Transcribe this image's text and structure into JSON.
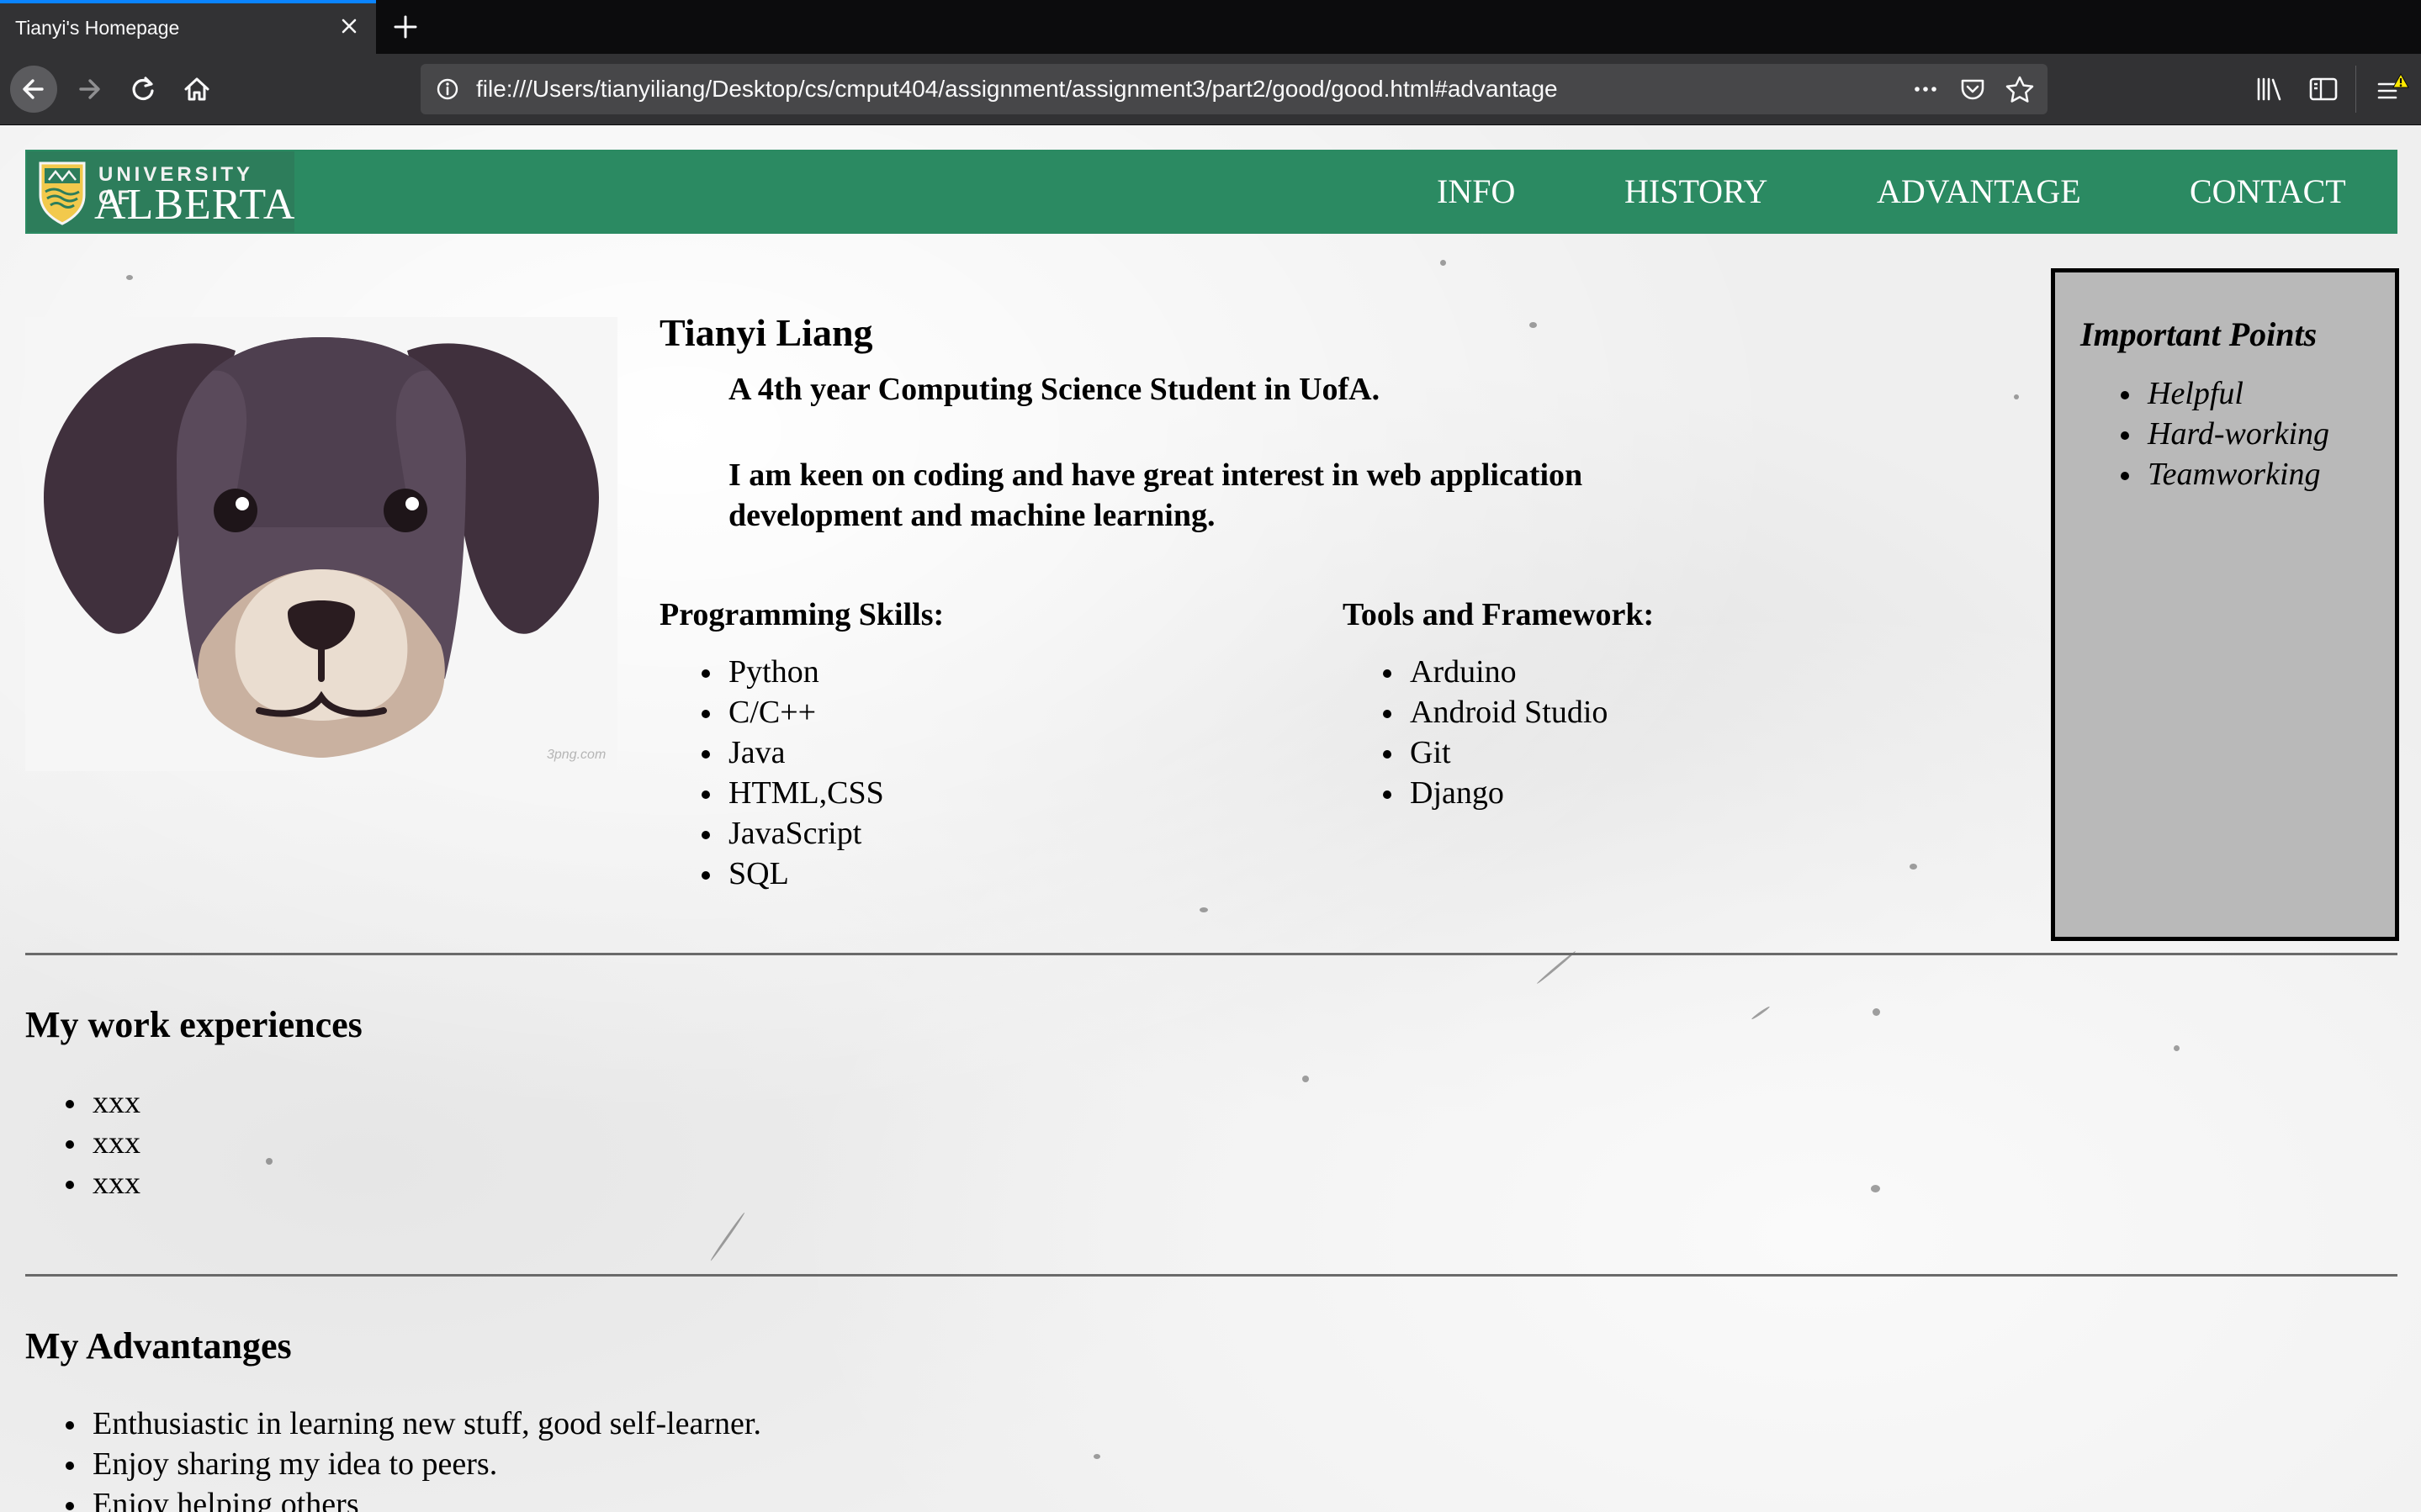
{
  "browser": {
    "tab_title": "Tianyi's Homepage",
    "url": "file:///Users/tianyiliang/Desktop/cs/cmput404/assignment/assignment3/part2/good/good.html#advantage"
  },
  "header": {
    "logo_line1": "UNIVERSITY OF",
    "logo_line2": "ALBERTA",
    "nav": [
      "INFO",
      "HISTORY",
      "ADVANTAGE",
      "CONTACT"
    ]
  },
  "profile": {
    "image_watermark": "3png.com",
    "name": "Tianyi Liang",
    "intro": "A 4th year Computing Science Student in UofA.",
    "bio": "I am keen on coding and have great interest in web application development and machine learning.",
    "skills_heading": "Programming Skills:",
    "skills": [
      "Python",
      "C/C++",
      "Java",
      "HTML,CSS",
      "JavaScript",
      "SQL"
    ],
    "tools_heading": "Tools and Framework:",
    "tools": [
      "Arduino",
      "Android Studio",
      "Git",
      "Django"
    ]
  },
  "aside": {
    "title": "Important Points",
    "points": [
      "Helpful",
      "Hard-working",
      "Teamworking"
    ]
  },
  "work": {
    "heading": "My work experiences",
    "items": [
      "xxx",
      "xxx",
      "xxx"
    ]
  },
  "advantages": {
    "heading": "My Advantanges",
    "items": [
      "Enthusiastic in learning new stuff, good self-learner.",
      "Enjoy sharing my idea to peers.",
      "Enjoy helping others"
    ]
  },
  "colors": {
    "header_green": "#2b8a62",
    "aside_gray": "#b9b9b9",
    "chrome_dark": "#323234",
    "tab_accent": "#0a84ff"
  }
}
